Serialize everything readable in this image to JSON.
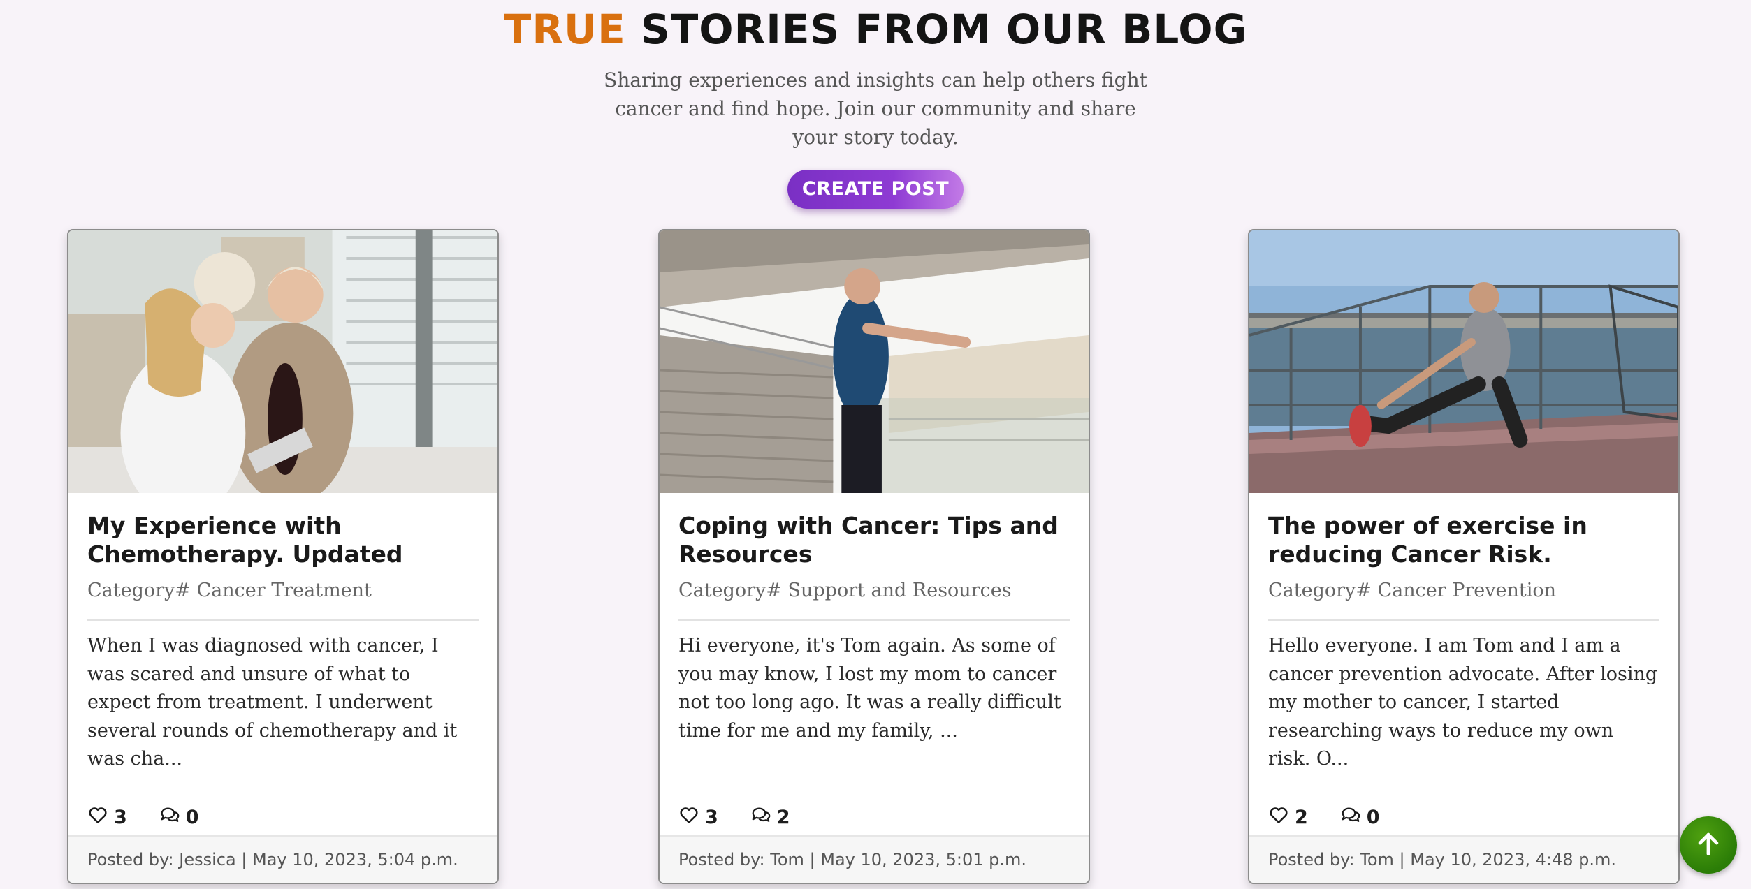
{
  "header": {
    "title_accent": "TRUE",
    "title_rest": "STORIES FROM OUR BLOG",
    "subtitle": "Sharing experiences and insights can help others fight cancer and find hope. Join our community and share your story today.",
    "create_label": "CREATE POST"
  },
  "posts": [
    {
      "title": "My Experience with Chemotherapy. Updated",
      "category": "Category# Cancer Treatment",
      "excerpt": "When I was diagnosed with cancer, I was scared and unsure of what to expect from treatment. I underwent several rounds of chemotherapy and it was cha...",
      "likes": "3",
      "comments": "0",
      "footer": "Posted by: Jessica | May 10, 2023, 5:04 p.m."
    },
    {
      "title": "Coping with Cancer: Tips and Resources",
      "category": "Category# Support and Resources",
      "excerpt": "Hi everyone, it's Tom again. As some of you may know, I lost my mom to cancer not too long ago. It was a really difficult time for me and my family, ...",
      "likes": "3",
      "comments": "2",
      "footer": "Posted by: Tom | May 10, 2023, 5:01 p.m."
    },
    {
      "title": "The power of exercise in reducing Cancer Risk.",
      "category": "Category# Cancer Prevention",
      "excerpt": "Hello everyone. I am Tom and I am a cancer prevention advocate. After losing my mother to cancer, I started researching ways to reduce my own risk. O...",
      "likes": "2",
      "comments": "0",
      "footer": "Posted by: Tom | May 10, 2023, 4:48 p.m."
    }
  ],
  "icons": {
    "like": "heart-icon",
    "comment": "comments-icon",
    "scroll_top": "arrow-up-icon"
  },
  "colors": {
    "accent": "#d9700f",
    "button_purple": "#7a2fc4",
    "scroll_green": "#2b7d07"
  }
}
